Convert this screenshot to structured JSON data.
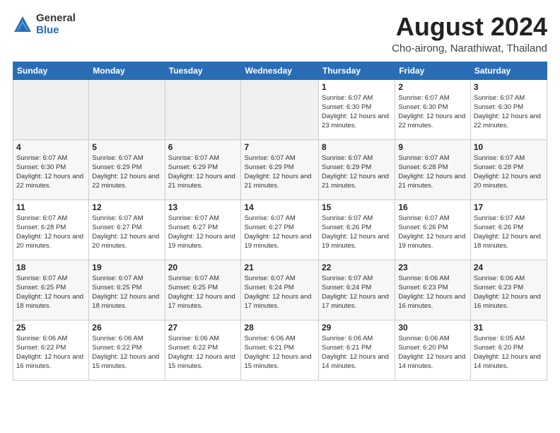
{
  "header": {
    "logo_general": "General",
    "logo_blue": "Blue",
    "month_title": "August 2024",
    "location": "Cho-airong, Narathiwat, Thailand"
  },
  "weekdays": [
    "Sunday",
    "Monday",
    "Tuesday",
    "Wednesday",
    "Thursday",
    "Friday",
    "Saturday"
  ],
  "weeks": [
    [
      {
        "day": "",
        "detail": ""
      },
      {
        "day": "",
        "detail": ""
      },
      {
        "day": "",
        "detail": ""
      },
      {
        "day": "",
        "detail": ""
      },
      {
        "day": "1",
        "detail": "Sunrise: 6:07 AM\nSunset: 6:30 PM\nDaylight: 12 hours\nand 23 minutes."
      },
      {
        "day": "2",
        "detail": "Sunrise: 6:07 AM\nSunset: 6:30 PM\nDaylight: 12 hours\nand 22 minutes."
      },
      {
        "day": "3",
        "detail": "Sunrise: 6:07 AM\nSunset: 6:30 PM\nDaylight: 12 hours\nand 22 minutes."
      }
    ],
    [
      {
        "day": "4",
        "detail": "Sunrise: 6:07 AM\nSunset: 6:30 PM\nDaylight: 12 hours\nand 22 minutes."
      },
      {
        "day": "5",
        "detail": "Sunrise: 6:07 AM\nSunset: 6:29 PM\nDaylight: 12 hours\nand 22 minutes."
      },
      {
        "day": "6",
        "detail": "Sunrise: 6:07 AM\nSunset: 6:29 PM\nDaylight: 12 hours\nand 21 minutes."
      },
      {
        "day": "7",
        "detail": "Sunrise: 6:07 AM\nSunset: 6:29 PM\nDaylight: 12 hours\nand 21 minutes."
      },
      {
        "day": "8",
        "detail": "Sunrise: 6:07 AM\nSunset: 6:29 PM\nDaylight: 12 hours\nand 21 minutes."
      },
      {
        "day": "9",
        "detail": "Sunrise: 6:07 AM\nSunset: 6:28 PM\nDaylight: 12 hours\nand 21 minutes."
      },
      {
        "day": "10",
        "detail": "Sunrise: 6:07 AM\nSunset: 6:28 PM\nDaylight: 12 hours\nand 20 minutes."
      }
    ],
    [
      {
        "day": "11",
        "detail": "Sunrise: 6:07 AM\nSunset: 6:28 PM\nDaylight: 12 hours\nand 20 minutes."
      },
      {
        "day": "12",
        "detail": "Sunrise: 6:07 AM\nSunset: 6:27 PM\nDaylight: 12 hours\nand 20 minutes."
      },
      {
        "day": "13",
        "detail": "Sunrise: 6:07 AM\nSunset: 6:27 PM\nDaylight: 12 hours\nand 19 minutes."
      },
      {
        "day": "14",
        "detail": "Sunrise: 6:07 AM\nSunset: 6:27 PM\nDaylight: 12 hours\nand 19 minutes."
      },
      {
        "day": "15",
        "detail": "Sunrise: 6:07 AM\nSunset: 6:26 PM\nDaylight: 12 hours\nand 19 minutes."
      },
      {
        "day": "16",
        "detail": "Sunrise: 6:07 AM\nSunset: 6:26 PM\nDaylight: 12 hours\nand 19 minutes."
      },
      {
        "day": "17",
        "detail": "Sunrise: 6:07 AM\nSunset: 6:26 PM\nDaylight: 12 hours\nand 18 minutes."
      }
    ],
    [
      {
        "day": "18",
        "detail": "Sunrise: 6:07 AM\nSunset: 6:25 PM\nDaylight: 12 hours\nand 18 minutes."
      },
      {
        "day": "19",
        "detail": "Sunrise: 6:07 AM\nSunset: 6:25 PM\nDaylight: 12 hours\nand 18 minutes."
      },
      {
        "day": "20",
        "detail": "Sunrise: 6:07 AM\nSunset: 6:25 PM\nDaylight: 12 hours\nand 17 minutes."
      },
      {
        "day": "21",
        "detail": "Sunrise: 6:07 AM\nSunset: 6:24 PM\nDaylight: 12 hours\nand 17 minutes."
      },
      {
        "day": "22",
        "detail": "Sunrise: 6:07 AM\nSunset: 6:24 PM\nDaylight: 12 hours\nand 17 minutes."
      },
      {
        "day": "23",
        "detail": "Sunrise: 6:06 AM\nSunset: 6:23 PM\nDaylight: 12 hours\nand 16 minutes."
      },
      {
        "day": "24",
        "detail": "Sunrise: 6:06 AM\nSunset: 6:23 PM\nDaylight: 12 hours\nand 16 minutes."
      }
    ],
    [
      {
        "day": "25",
        "detail": "Sunrise: 6:06 AM\nSunset: 6:22 PM\nDaylight: 12 hours\nand 16 minutes."
      },
      {
        "day": "26",
        "detail": "Sunrise: 6:06 AM\nSunset: 6:22 PM\nDaylight: 12 hours\nand 15 minutes."
      },
      {
        "day": "27",
        "detail": "Sunrise: 6:06 AM\nSunset: 6:22 PM\nDaylight: 12 hours\nand 15 minutes."
      },
      {
        "day": "28",
        "detail": "Sunrise: 6:06 AM\nSunset: 6:21 PM\nDaylight: 12 hours\nand 15 minutes."
      },
      {
        "day": "29",
        "detail": "Sunrise: 6:06 AM\nSunset: 6:21 PM\nDaylight: 12 hours\nand 14 minutes."
      },
      {
        "day": "30",
        "detail": "Sunrise: 6:06 AM\nSunset: 6:20 PM\nDaylight: 12 hours\nand 14 minutes."
      },
      {
        "day": "31",
        "detail": "Sunrise: 6:05 AM\nSunset: 6:20 PM\nDaylight: 12 hours\nand 14 minutes."
      }
    ]
  ]
}
